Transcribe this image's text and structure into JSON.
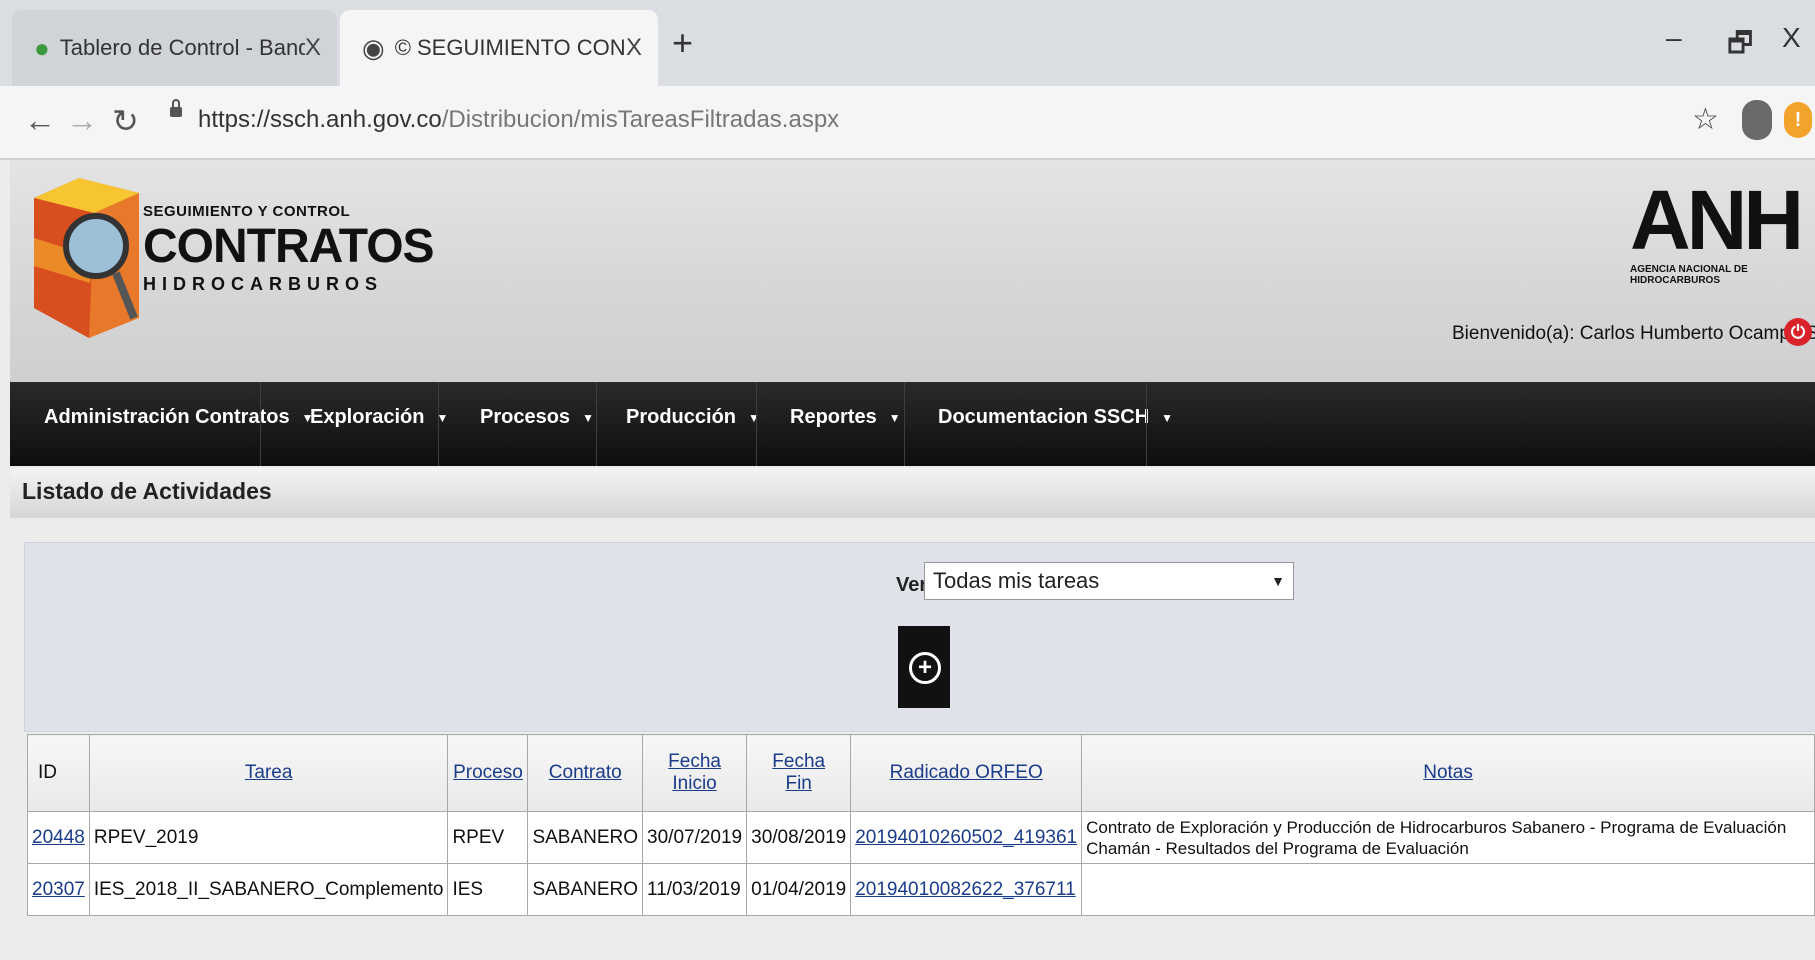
{
  "browser": {
    "tabs": [
      {
        "title": "Tablero de Control - Bandeja de",
        "close": "X"
      },
      {
        "title": "© SEGUIMIENTO CONTRATOS v",
        "close": "X"
      }
    ],
    "new_tab": "+",
    "window_controls": {
      "minimize": "–",
      "restore": "🗗",
      "close": "X"
    },
    "url_host": "https://ssch.anh.gov.co",
    "url_path": "/Distribucion/misTareasFiltradas.aspx"
  },
  "header": {
    "logo_small": "SEGUIMIENTO Y CONTROL",
    "logo_big": "CONTRATOS",
    "logo_sub": "HIDROCARBUROS",
    "anh_word": "ANH",
    "anh_sub": "AGENCIA NACIONAL DE HIDROCARBUROS",
    "welcome": "Bienvenido(a): Carlos Humberto Ocampo Silva"
  },
  "menu": [
    {
      "label": "Administración Contratos"
    },
    {
      "label": "Exploración"
    },
    {
      "label": "Procesos"
    },
    {
      "label": "Producción"
    },
    {
      "label": "Reportes"
    },
    {
      "label": "Documentacion SSCH"
    }
  ],
  "section_title": "Listado de Actividades",
  "filter": {
    "label": "Ver:",
    "selected": "Todas mis tareas"
  },
  "table": {
    "headers": {
      "id": "ID",
      "tarea": "Tarea",
      "proceso": "Proceso",
      "contrato": "Contrato",
      "fecha_inicio_1": "Fecha",
      "fecha_inicio_2": "Inicio",
      "fecha_fin_1": "Fecha",
      "fecha_fin_2": "Fin",
      "radicado": "Radicado ORFEO",
      "notas": "Notas"
    },
    "rows": [
      {
        "id": "20448",
        "tarea": "RPEV_2019",
        "proceso": "RPEV",
        "contrato": "SABANERO",
        "fecha_inicio": "30/07/2019",
        "fecha_fin": "30/08/2019",
        "radicado": "20194010260502_419361",
        "notas": "Contrato de Exploración y Producción de Hidrocarburos Sabanero - Programa de Evaluación Chamán - Resultados del Programa de Evaluación"
      },
      {
        "id": "20307",
        "tarea": "IES_2018_II_SABANERO_Complemento",
        "proceso": "IES",
        "contrato": "SABANERO",
        "fecha_inicio": "11/03/2019",
        "fecha_fin": "01/04/2019",
        "radicado": "20194010082622_376711",
        "notas": ""
      }
    ]
  }
}
